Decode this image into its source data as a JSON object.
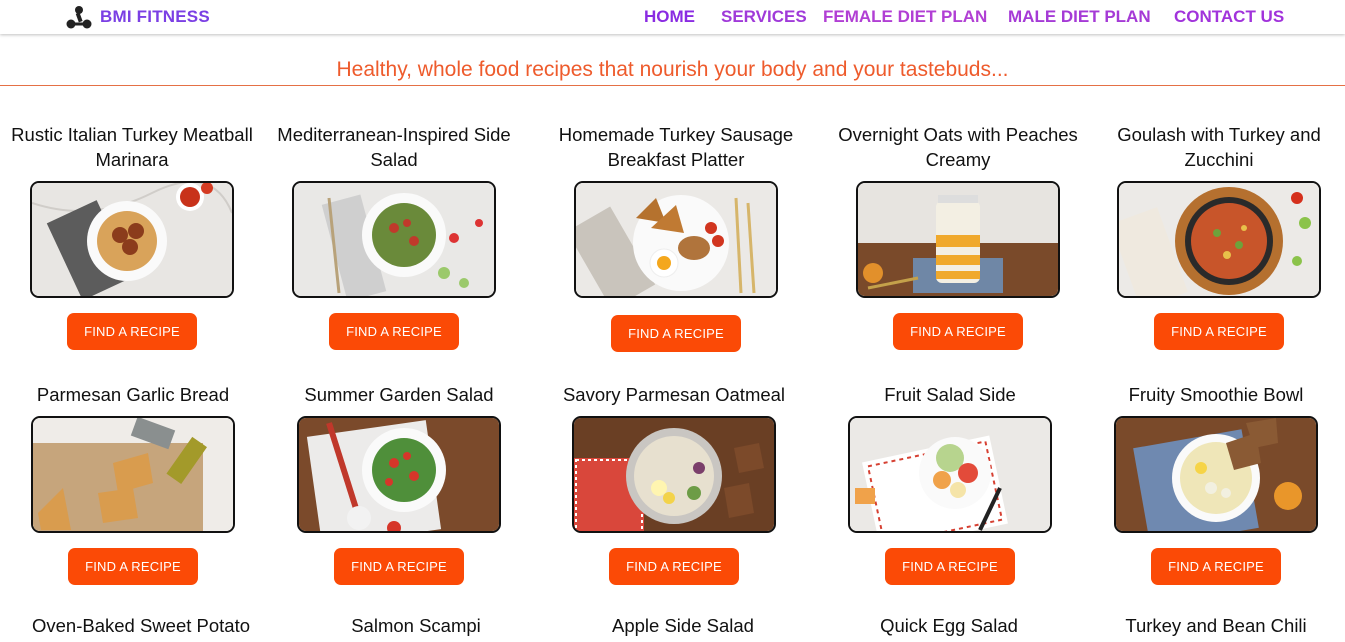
{
  "brand": {
    "name": "BMI FITNESS",
    "logo": "dumbbell-logo-icon"
  },
  "nav": {
    "home": "HOME",
    "services": "SERVICES",
    "female": "FEMALE DIET PLAN",
    "male": "MALE DIET PLAN",
    "contact": "CONTACT US"
  },
  "tagline": "Healthy, whole food recipes that nourish your body and your tastebuds...",
  "button_label": "FIND A RECIPE",
  "recipes": [
    {
      "title": "Rustic Italian Turkey Meatball Marinara",
      "image": "pasta-meatballs-image"
    },
    {
      "title": "Mediterranean-Inspired Side Salad",
      "image": "side-salad-image"
    },
    {
      "title": "Homemade Turkey Sausage Breakfast Platter",
      "image": "breakfast-platter-image"
    },
    {
      "title": "Overnight Oats with Peaches Creamy",
      "image": "overnight-oats-image"
    },
    {
      "title": "Goulash with Turkey and Zucchini",
      "image": "goulash-image"
    },
    {
      "title": "Parmesan Garlic Bread",
      "image": "garlic-bread-image"
    },
    {
      "title": "Summer Garden Salad",
      "image": "garden-salad-image"
    },
    {
      "title": "Savory Parmesan Oatmeal",
      "image": "savory-oatmeal-image"
    },
    {
      "title": "Fruit Salad Side",
      "image": "fruit-salad-image"
    },
    {
      "title": "Fruity Smoothie Bowl",
      "image": "smoothie-bowl-image"
    }
  ],
  "more_recipes": [
    "Oven-Baked Sweet Potato",
    "Salmon Scampi",
    "Apple Side Salad",
    "Quick Egg Salad",
    "Turkey and Bean Chili"
  ],
  "colors": {
    "accent": "#fb4a06",
    "tagline": "#ee5b2c",
    "nav_purple": "#7b3fe4"
  }
}
